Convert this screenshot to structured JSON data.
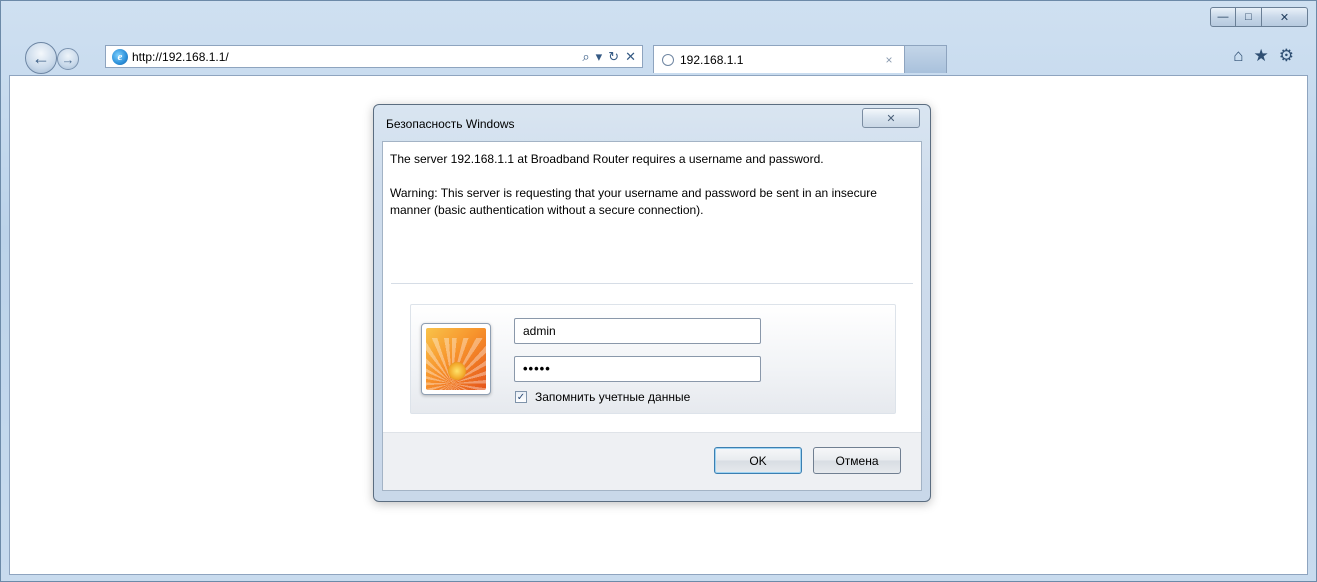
{
  "browser": {
    "address": {
      "url": "http://192.168.1.1/"
    },
    "tab": {
      "title": "192.168.1.1",
      "close": "×"
    },
    "window_controls": {
      "minimize": "—",
      "maximize": "□",
      "close": "✕"
    },
    "nav": {
      "back": "←",
      "forward": "→"
    },
    "addr_tools": {
      "search": "⌕",
      "dropdown": "▾",
      "refresh": "↻",
      "stop": "✕"
    },
    "toolbar_icons": {
      "home": "⌂",
      "favorites": "★",
      "tools": "⚙"
    }
  },
  "dialog": {
    "title": "Безопасность Windows",
    "close": "✕",
    "message": "The server 192.168.1.1 at Broadband Router requires a username and password.",
    "warning": "Warning: This server is requesting that your username and password be sent in an insecure manner (basic authentication without a secure connection).",
    "username_value": "admin",
    "password_value": "•••••",
    "remember_label": "Запомнить учетные данные",
    "remember_checked": "✓",
    "ok_label": "OK",
    "cancel_label": "Отмена"
  },
  "colors": {
    "frame": "#c8dbee",
    "dialog_frame": "#cfdded",
    "ok_border": "#3c7fb1"
  },
  "icons": [
    "back-icon",
    "forward-icon",
    "ie-icon",
    "search-icon",
    "refresh-icon",
    "stop-icon",
    "home-icon",
    "star-icon",
    "gear-icon",
    "close-icon",
    "user-tile-icon",
    "checkbox-icon"
  ]
}
